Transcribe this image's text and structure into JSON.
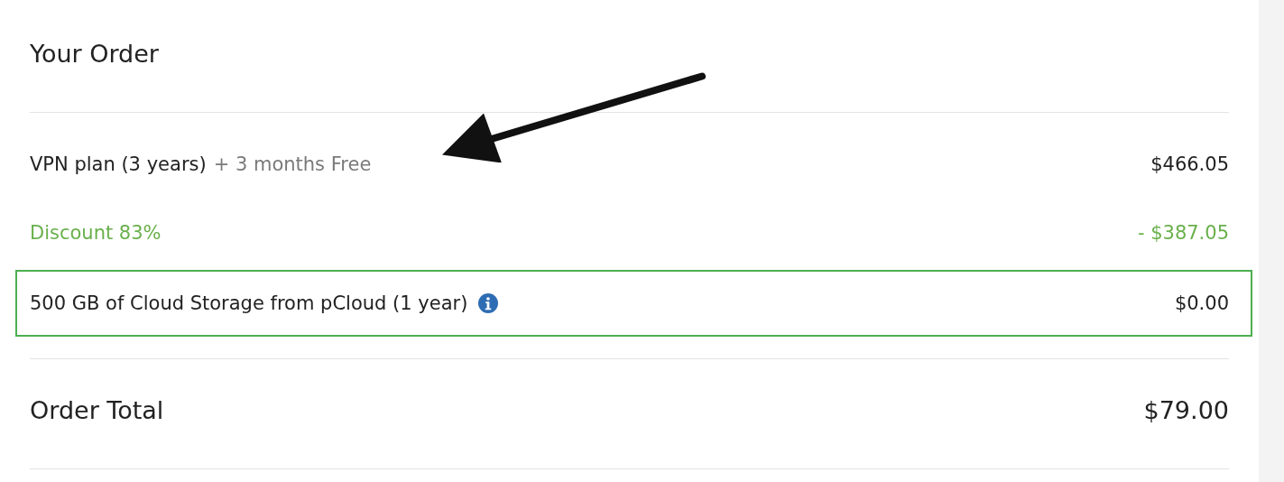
{
  "title": "Your Order",
  "items": [
    {
      "kind": "plan",
      "label": "VPN plan (3 years)",
      "note": "+ 3 months Free",
      "price": "$466.05"
    },
    {
      "kind": "discount",
      "label": "Discount 83%",
      "price": "- $387.05"
    },
    {
      "kind": "addon",
      "label": "500 GB of Cloud Storage from pCloud (1 year)",
      "price": "$0.00",
      "highlighted": true
    }
  ],
  "total": {
    "label": "Order Total",
    "price": "$79.00"
  }
}
